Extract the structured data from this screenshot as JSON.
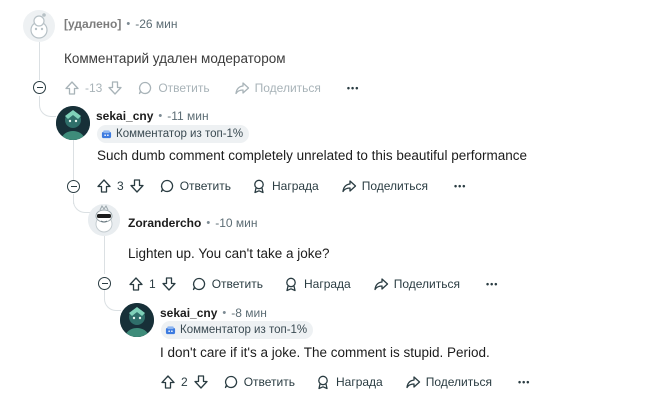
{
  "comments": [
    {
      "author": "[удалено]",
      "time": "-26 мин",
      "text": "Комментарий удален модератором",
      "votes": "-13",
      "actions": {
        "reply": "Ответить",
        "share": "Поделиться"
      }
    },
    {
      "author": "sekai_cny",
      "time": "-11 мин",
      "badge": "Комментатор из топ-1%",
      "text": "Such dumb comment completely unrelated to this beautiful performance",
      "votes": "3",
      "actions": {
        "reply": "Ответить",
        "award": "Награда",
        "share": "Поделиться"
      }
    },
    {
      "author": "Zorandercho",
      "time": "-10 мин",
      "text": "Lighten up. You can't take a joke?",
      "votes": "1",
      "actions": {
        "reply": "Ответить",
        "award": "Награда",
        "share": "Поделиться"
      }
    },
    {
      "author": "sekai_cny",
      "time": "-8 мин",
      "badge": "Комментатор из топ-1%",
      "text": "I don't care if it's a joke. The comment is stupid. Period.",
      "votes": "2",
      "actions": {
        "reply": "Ответить",
        "award": "Награда",
        "share": "Поделиться"
      }
    }
  ],
  "colors": {
    "text": "#1c1c1c",
    "muted": "#5c6c74",
    "disabled": "#a8b3b8",
    "thread_line": "#dbe0e3",
    "badge_bg": "#eef1f3"
  },
  "separator": "•",
  "more_label": "•••"
}
